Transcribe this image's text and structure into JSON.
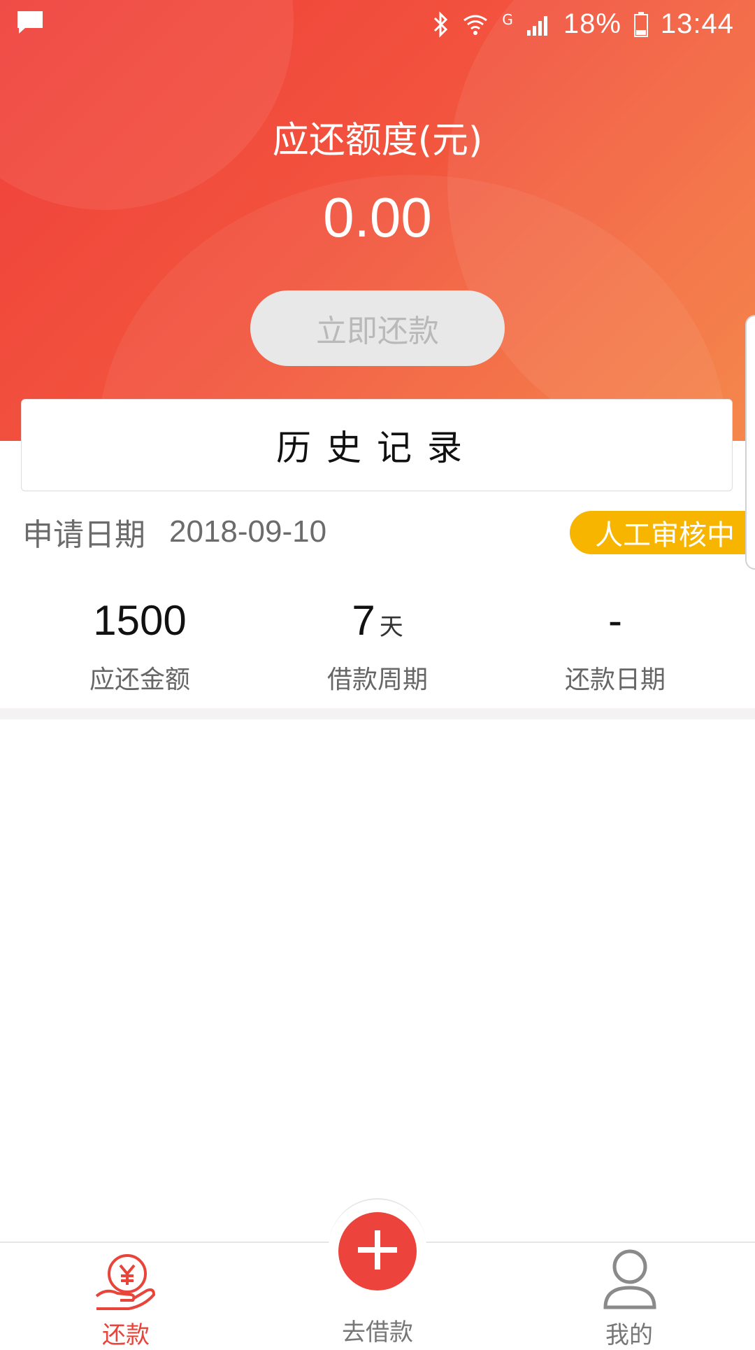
{
  "status_bar": {
    "battery": "18%",
    "time": "13:44",
    "network": "G"
  },
  "summary": {
    "title": "应还额度(元)",
    "amount": "0.00",
    "repay_button": "立即还款"
  },
  "history": {
    "label": "历史记录"
  },
  "record": {
    "apply_label": "申请日期",
    "apply_date": "2018-09-10",
    "status": "人工审核中",
    "stats": [
      {
        "value": "1500",
        "unit": "",
        "label": "应还金额"
      },
      {
        "value": "7",
        "unit": "天",
        "label": "借款周期"
      },
      {
        "value": "-",
        "unit": "",
        "label": "还款日期"
      }
    ]
  },
  "tabbar": {
    "repay": "还款",
    "borrow": "去借款",
    "mine": "我的"
  },
  "colors": {
    "brand_red": "#ec443c",
    "status_yellow": "#f7b500"
  }
}
